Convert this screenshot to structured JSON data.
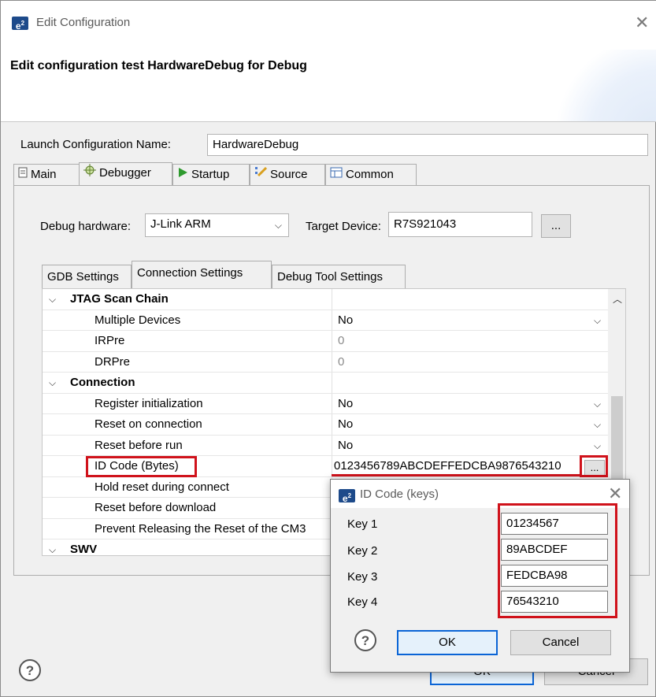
{
  "window": {
    "title": "Edit Configuration",
    "logo_text": "e",
    "logo_sup": "2",
    "banner_title": "Edit configuration test HardwareDebug for Debug"
  },
  "launch": {
    "label": "Launch Configuration Name:",
    "value": "HardwareDebug"
  },
  "tabs": [
    {
      "label": "Main",
      "icon": "main-doc-icon"
    },
    {
      "label": "Debugger",
      "icon": "bug-gear-icon"
    },
    {
      "label": "Startup",
      "icon": "play-icon"
    },
    {
      "label": "Source",
      "icon": "source-icon"
    },
    {
      "label": "Common",
      "icon": "common-table-icon"
    }
  ],
  "debugger": {
    "hw_label": "Debug hardware:",
    "hw_value": "J-Link ARM",
    "target_label": "Target Device:",
    "target_value": "R7S921043",
    "browse_label": "..."
  },
  "subtabs": [
    "GDB Settings",
    "Connection Settings",
    "Debug Tool Settings"
  ],
  "grid": {
    "sections": {
      "jtag": "JTAG Scan Chain",
      "connection": "Connection",
      "swv": "SWV"
    },
    "rows": [
      {
        "name": "Multiple Devices",
        "value": "No"
      },
      {
        "name": "IRPre",
        "value": "0"
      },
      {
        "name": "DRPre",
        "value": "0"
      },
      {
        "name": "Register initialization",
        "value": "No"
      },
      {
        "name": "Reset on connection",
        "value": "No"
      },
      {
        "name": "Reset before run",
        "value": "No"
      },
      {
        "name": "ID Code (Bytes)",
        "value": "0123456789ABCDEFFEDCBA9876543210"
      },
      {
        "name": "Hold reset during connect",
        "value": ""
      },
      {
        "name": "Reset before download",
        "value": ""
      },
      {
        "name": "Prevent Releasing the Reset of the CM3",
        "value": ""
      }
    ],
    "ellipsis": "..."
  },
  "main_buttons": {
    "ok": "OK",
    "cancel": "Cancel",
    "help": "?"
  },
  "id_dialog": {
    "title": "ID Code (keys)",
    "keys": [
      {
        "label": "Key 1",
        "value": "01234567"
      },
      {
        "label": "Key 2",
        "value": "89ABCDEF"
      },
      {
        "label": "Key 3",
        "value": "FEDCBA98"
      },
      {
        "label": "Key 4",
        "value": "76543210"
      }
    ],
    "ok": "OK",
    "cancel": "Cancel",
    "help": "?"
  },
  "colors": {
    "highlight_red": "#d0121b",
    "accent_blue": "#0a64d6",
    "logo_blue": "#1d4a8a"
  }
}
